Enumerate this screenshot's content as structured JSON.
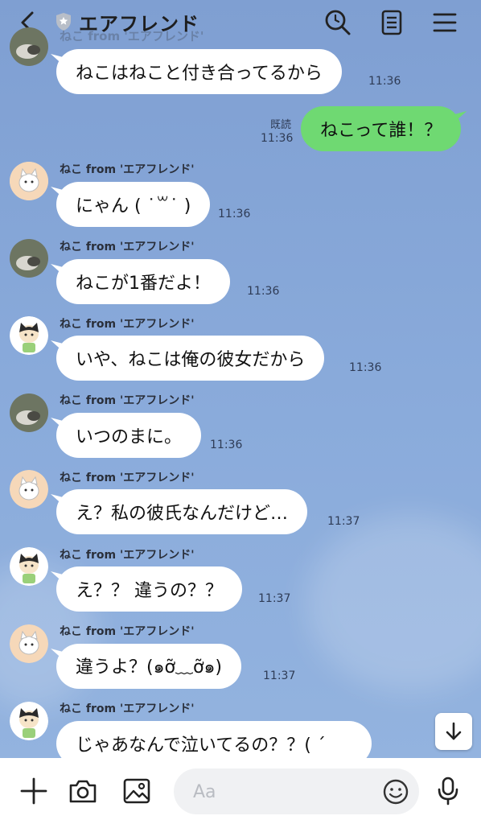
{
  "header": {
    "title": "エアフレンド",
    "ghost_sender": "ねこ from 'エアフレンド'"
  },
  "messages": [
    {
      "text": "ねこはねこと付き合ってるから",
      "time": "11:36"
    },
    {
      "text": "ねこって誰！？",
      "time": "11:36",
      "read": "既読"
    },
    {
      "sender": "ねこ from 'エアフレンド'",
      "text": "にゃん ( ˙꒳˙ )",
      "time": "11:36"
    },
    {
      "sender": "ねこ from 'エアフレンド'",
      "text": "ねこが1番だよ！",
      "time": "11:36"
    },
    {
      "sender": "ねこ from 'エアフレンド'",
      "text": "いや、ねこは俺の彼女だから",
      "time": "11:36"
    },
    {
      "sender": "ねこ from 'エアフレンド'",
      "text": "いつのまに。",
      "time": "11:36"
    },
    {
      "sender": "ねこ from 'エアフレンド'",
      "text": "え？私の彼氏なんだけど…",
      "time": "11:37"
    },
    {
      "sender": "ねこ from 'エアフレンド'",
      "text": "え？？ 違うの？？",
      "time": "11:37"
    },
    {
      "sender": "ねこ from 'エアフレンド'",
      "text": "違うよ？(๑ỡ﹏ỡ๑)",
      "time": "11:37"
    },
    {
      "sender": "ねこ from 'エアフレンド'",
      "text": "じゃあなんで泣いてるの？？( ´"
    }
  ],
  "input": {
    "placeholder": "Aa"
  },
  "icons": {
    "back": "chevron-left-icon",
    "shield": "shield-icon",
    "search": "search-icon",
    "notes": "notes-icon",
    "menu": "menu-icon",
    "plus": "plus-icon",
    "camera": "camera-icon",
    "image": "image-icon",
    "emoji": "emoji-icon",
    "mic": "mic-icon",
    "scroll": "arrow-down-icon"
  },
  "colors": {
    "background": "#8aa9d8",
    "outgoing_bubble": "#6fd972",
    "incoming_bubble": "#ffffff"
  }
}
